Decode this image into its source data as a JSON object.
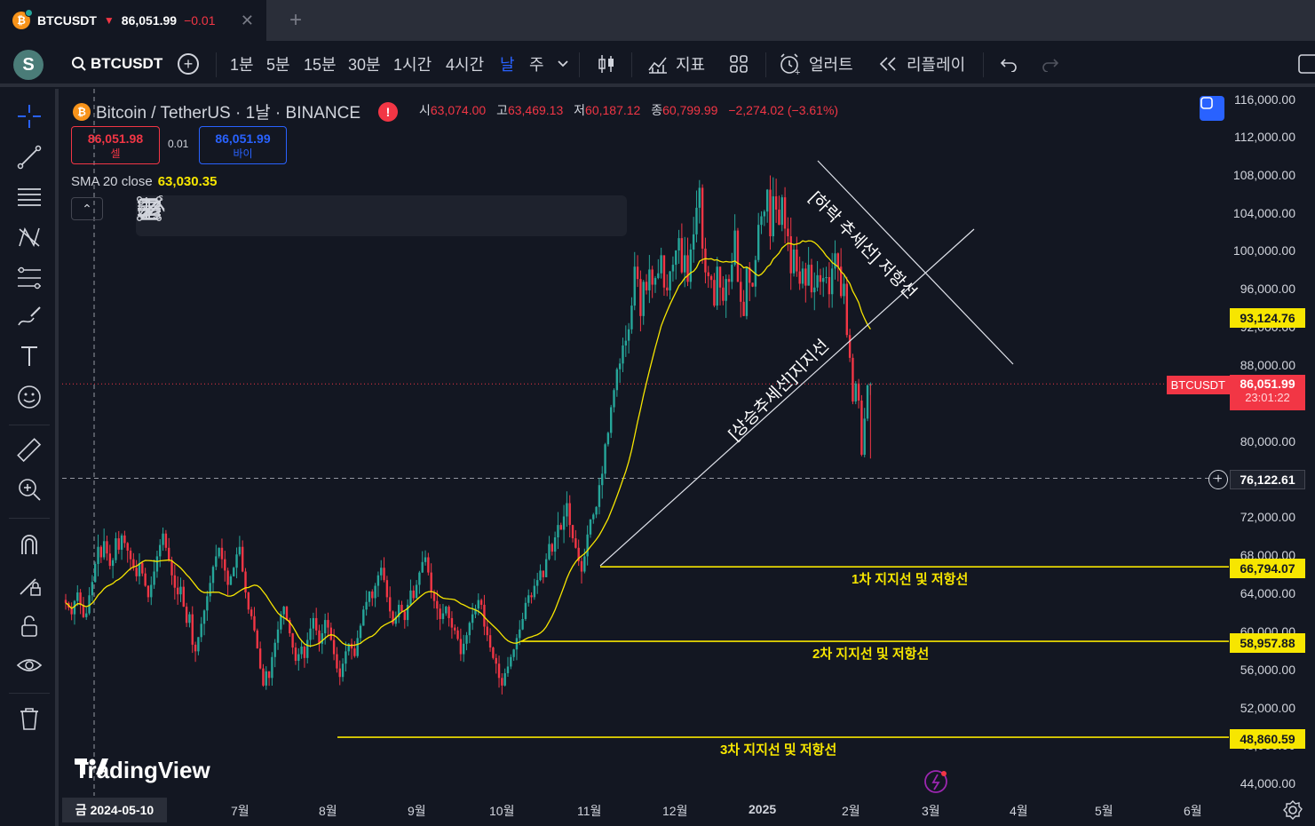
{
  "tab": {
    "symbol": "BTCUSDT",
    "price": "86,051.99",
    "change": "−0.01"
  },
  "toolbar": {
    "avatar": "S",
    "symbol": "BTCUSDT",
    "intervals": [
      "1분",
      "5분",
      "15분",
      "30분",
      "1시간",
      "4시간",
      "날",
      "주"
    ],
    "active_interval": "날",
    "indicators": "지표",
    "alert": "얼러트",
    "replay": "리플레이"
  },
  "legend": {
    "title": "Bitcoin / TetherUS · 1날 · BINANCE",
    "ohlc": [
      {
        "k": "시",
        "v": "63,074.00"
      },
      {
        "k": "고",
        "v": "63,469.13"
      },
      {
        "k": "저",
        "v": "60,187.12"
      },
      {
        "k": "종",
        "v": "60,799.99"
      }
    ],
    "change": "−2,274.02 (−3.61%)",
    "sell_price": "86,051.98",
    "sell_label": "셀",
    "spread": "0.01",
    "buy_price": "86,051.99",
    "buy_label": "바이",
    "sma_label": "SMA 20 close",
    "sma_value": "63,030.35"
  },
  "price_axis": [
    "116,000.00",
    "112,000.00",
    "108,000.00",
    "104,000.00",
    "100,000.00",
    "96,000.00",
    "92,000.00",
    "88,000.00",
    "80,000.00",
    "72,000.00",
    "68,000.00",
    "64,000.00",
    "60,000.00",
    "56,000.00",
    "52,000.00",
    "48,000.00",
    "44,000.00"
  ],
  "tags": {
    "sma": "93,124.76",
    "current_name": "BTCUSDT",
    "current_price": "86,051.99",
    "current_time": "23:01:22",
    "crosshair": "76,122.61",
    "level1": "66,794.07",
    "level2": "58,957.88",
    "level3": "48,860.59"
  },
  "annotations": {
    "level1": "1차 지지선 및 저항선",
    "level2": "2차 지지선 및 저항선",
    "level3": "3차 지지선 및 저항선",
    "down_trend": "[하락 추세선] 저항선",
    "up_trend": "[상승추세선]지지선"
  },
  "time_axis": {
    "crosshair": "금 2024-05-10",
    "labels": [
      "7월",
      "8월",
      "9월",
      "10월",
      "11월",
      "12월",
      "2025",
      "2월",
      "3월",
      "4월",
      "5월",
      "6월"
    ]
  },
  "logo": "TradingView",
  "colors": {
    "up": "#26a69a",
    "down": "#f23645",
    "sma": "#f7e600",
    "accent": "#2962ff",
    "bg": "#131722"
  },
  "chart_data": {
    "type": "candlestick",
    "series": [
      {
        "name": "SMA 20 close"
      }
    ],
    "closes": [
      63000,
      62500,
      61800,
      63200,
      64100,
      62800,
      61500,
      61900,
      63800,
      65200,
      67100,
      68900,
      67800,
      69500,
      68200,
      66900,
      67500,
      69800,
      68600,
      70100,
      69300,
      68500,
      67600,
      66700,
      65800,
      67200,
      66100,
      64800,
      63600,
      64900,
      66300,
      67900,
      69100,
      70300,
      68800,
      67500,
      65900,
      64600,
      63900,
      64700,
      62600,
      60900,
      61800,
      58600,
      57900,
      59400,
      60800,
      62200,
      63700,
      65100,
      66800,
      67900,
      68800,
      67600,
      66400,
      64900,
      65800,
      66700,
      68100,
      68900,
      66300,
      64100,
      62300,
      61600,
      60100,
      58200,
      56100,
      54300,
      55800,
      55100,
      57300,
      58800,
      60200,
      61800,
      62600,
      61200,
      59800,
      58300,
      56900,
      57600,
      58400,
      57200,
      59100,
      60300,
      61400,
      60100,
      58700,
      59800,
      61200,
      60400,
      59100,
      57600,
      56100,
      55200,
      56600,
      57900,
      58700,
      58200,
      57400,
      59300,
      60600,
      62300,
      63100,
      64200,
      63500,
      64800,
      65900,
      66700,
      65400,
      63600,
      62100,
      60800,
      61500,
      62800,
      62100,
      61200,
      62800,
      64300,
      63500,
      64900,
      66200,
      67300,
      67800,
      66200,
      64100,
      63200,
      62400,
      61300,
      61900,
      62600,
      61400,
      60400,
      60100,
      59200,
      57600,
      58700,
      59600,
      60900,
      61800,
      62400,
      63300,
      62800,
      60500,
      59600,
      58300,
      57200,
      56600,
      55100,
      54300,
      55600,
      56300,
      57300,
      58100,
      59300,
      60200,
      61300,
      63000,
      63800,
      63600,
      64800,
      65400,
      66400,
      65700,
      67600,
      69200,
      68400,
      69900,
      71200,
      70700,
      72100,
      73500,
      71200,
      69800,
      68800,
      67400,
      66300,
      67900,
      70200,
      71800,
      72300,
      73100,
      75400,
      76600,
      79700,
      80900,
      83600,
      85400,
      87600,
      88200,
      90100,
      90600,
      91800,
      94300,
      98400,
      97100,
      93200,
      96800,
      95900,
      98100,
      96500,
      97200,
      97700,
      99600,
      96200,
      95900,
      97900,
      98600,
      100100,
      101400,
      97800,
      99600,
      96800,
      100200,
      101800,
      104600,
      106700,
      100300,
      97800,
      97400,
      97000,
      94300,
      98400,
      96200,
      94800,
      97100,
      96800,
      98600,
      102200,
      96800,
      94700,
      93200,
      98300,
      96700,
      96300,
      99100,
      102800,
      103700,
      104200,
      106500,
      101600,
      105800,
      104400,
      102800,
      105700,
      102400,
      101600,
      97700,
      100200,
      97900,
      96600,
      98200,
      96400,
      98600,
      95700,
      96200,
      97500,
      96800,
      97200,
      97300,
      95500,
      98200,
      99800,
      98400,
      95300,
      96600,
      91200,
      88800,
      84200,
      86100,
      84300,
      78600,
      82400,
      85900,
      86051
    ]
  }
}
